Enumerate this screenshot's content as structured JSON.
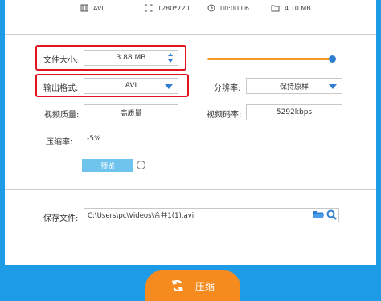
{
  "file_info": {
    "format": "AVI",
    "resolution": "1280*720",
    "duration": "00:00:06",
    "source_size": "4.10 MB"
  },
  "settings": {
    "file_size_label": "文件大小:",
    "file_size_value": "3.88 MB",
    "output_format_label": "输出格式:",
    "output_format_value": "AVI",
    "resolution_label": "分辨率:",
    "resolution_value": "保持原样",
    "video_quality_label": "视频质量:",
    "video_quality_value": "高质量",
    "video_bitrate_label": "视频码率:",
    "video_bitrate_value": "5292kbps",
    "compression_rate_label": "压缩率:",
    "compression_rate_value": "-5%",
    "preview_label": "预览",
    "size_slider_fraction": 0.97
  },
  "save": {
    "label": "保存文件:",
    "path": "C:\\Users\\pc\\Videos\\合并1(1).avi"
  },
  "action": {
    "compress_label": "压缩"
  },
  "colors": {
    "accent_blue": "#1e9be6",
    "orange": "#f58a1f",
    "highlight_red": "#e0141e"
  }
}
